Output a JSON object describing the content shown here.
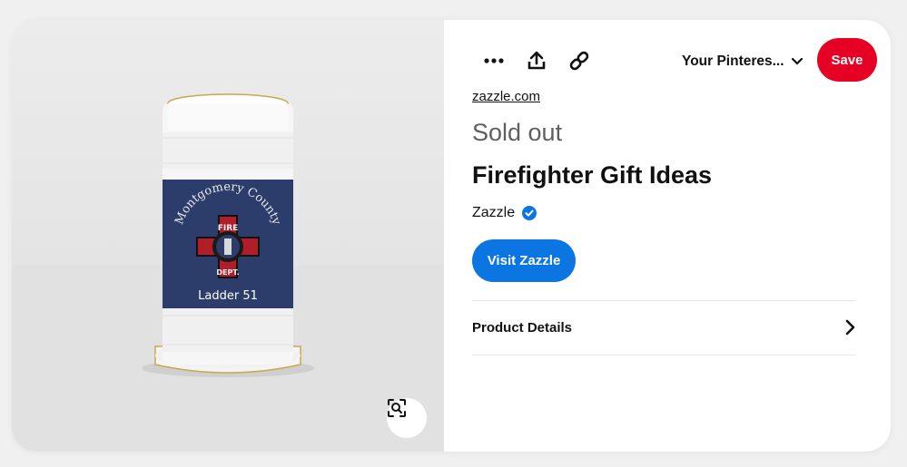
{
  "pin": {
    "image": {
      "mug_label_top": "Montgomery County",
      "mug_label_bottom": "Ladder 51",
      "badge_top": "FIRE",
      "badge_bottom": "DEPT.",
      "lens_icon": "visual-search-icon"
    },
    "toolbar": {
      "more_icon": "more-icon",
      "share_icon": "share-icon",
      "link_icon": "link-icon",
      "board_label": "Your Pinteres...",
      "board_icon": "chevron-down-icon",
      "save_label": "Save"
    },
    "domain": "zazzle.com",
    "status": "Sold out",
    "title": "Firefighter Gift Ideas",
    "creator": {
      "name": "Zazzle",
      "verified_icon": "verified-check-icon"
    },
    "visit_label": "Visit Zazzle",
    "details_label": "Product Details",
    "details_icon": "chevron-right-icon"
  },
  "colors": {
    "save": "#e60023",
    "visit": "#0b76e2",
    "verified": "#0b76e2",
    "mug_label": "#2c3d6b",
    "badge_red": "#b11e2a"
  }
}
